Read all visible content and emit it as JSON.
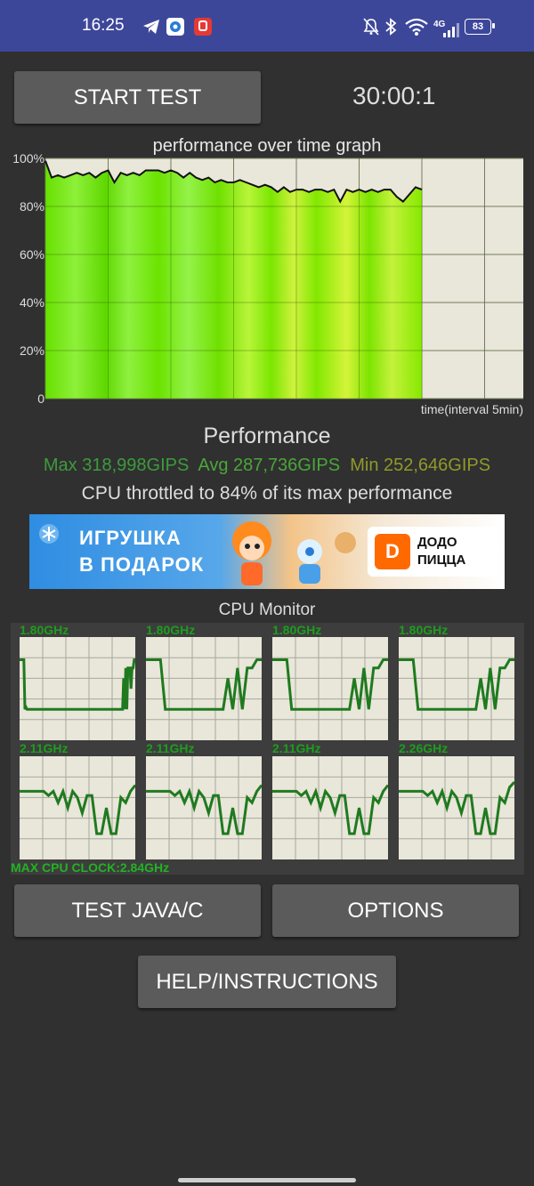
{
  "status_bar": {
    "time": "16:25",
    "network_label": "4G",
    "battery": "83",
    "icons": [
      "telegram-icon",
      "app-icon",
      "notification-app-icon",
      "bell-muted-icon",
      "bluetooth-icon",
      "wifi-icon",
      "signal-icon",
      "battery-icon"
    ]
  },
  "toolbar": {
    "start_label": "START TEST",
    "timer": "30:00:1"
  },
  "graph": {
    "title": "performance over time graph",
    "y_ticks": [
      "100%",
      "80%",
      "60%",
      "40%",
      "20%",
      "0"
    ],
    "x_label": "time(interval 5min)"
  },
  "chart_data": {
    "type": "area",
    "title": "performance over time graph",
    "xlabel": "time(interval 5min)",
    "ylabel": "",
    "ylim": [
      0,
      100
    ],
    "x_range_minutes": [
      0,
      30
    ],
    "grid": true,
    "series": [
      {
        "name": "",
        "x_minutes": [
          0,
          0.5,
          1,
          1.5,
          2,
          2.5,
          3,
          3.5,
          4,
          4.5,
          5,
          5.5,
          6,
          6.5,
          7,
          7.5,
          8,
          8.5,
          9,
          9.5,
          10,
          10.5,
          11,
          11.5,
          12,
          12.5,
          13,
          13.5,
          14,
          14.5,
          15,
          15.5,
          16,
          16.5,
          17,
          17.5,
          18,
          18.5,
          19,
          19.5,
          20,
          20.5,
          21,
          21.5,
          22,
          22.5,
          23,
          23.5,
          24,
          24.5,
          25,
          25.5,
          26,
          26.5,
          27,
          27.5,
          28,
          28.5,
          29,
          29.5,
          30
        ],
        "values": [
          99,
          92,
          93,
          92,
          93,
          94,
          93,
          94,
          92,
          94,
          95,
          90,
          94,
          93,
          94,
          93,
          95,
          95,
          95,
          94,
          95,
          94,
          92,
          94,
          92,
          91,
          92,
          90,
          91,
          90,
          90,
          91,
          90,
          89,
          88,
          89,
          88,
          86,
          88,
          86,
          87,
          87,
          86,
          87,
          87,
          86,
          87,
          82,
          87,
          86,
          87,
          86,
          87,
          86,
          87,
          87,
          84,
          82,
          85,
          88,
          87
        ]
      }
    ]
  },
  "performance": {
    "title": "Performance",
    "max": "Max 318,998GIPS",
    "avg": "Avg 287,736GIPS",
    "min": "Min 252,646GIPS",
    "max_color": "#3d9b3d",
    "avg_color": "#4aa63a",
    "min_color": "#8f9a2a",
    "throttle": "CPU throttled to 84% of its max performance"
  },
  "ad": {
    "line1": "ИГРУШКА",
    "line2": "В ПОДАРОК",
    "brand_line1": "ДОДО",
    "brand_line2": "ПИЦЦА",
    "brand_mark": "D"
  },
  "cpu_monitor": {
    "title": "CPU Monitor",
    "cores": [
      {
        "freq": "1.80GHz",
        "levels": [
          0.78,
          0.78,
          0.78,
          0.78,
          0.78,
          0.3,
          0.32,
          0.3,
          0.3,
          0.3,
          0.3,
          0.3,
          0.3,
          0.3,
          0.3,
          0.3,
          0.3,
          0.3,
          0.3,
          0.3,
          0.3,
          0.3,
          0.3,
          0.3,
          0.3,
          0.3,
          0.3,
          0.3,
          0.3,
          0.3,
          0.3,
          0.3,
          0.3,
          0.3,
          0.3,
          0.3,
          0.3,
          0.3,
          0.3,
          0.3,
          0.3,
          0.3,
          0.3,
          0.3,
          0.3,
          0.3,
          0.3,
          0.3,
          0.3,
          0.3,
          0.3,
          0.3,
          0.3,
          0.3,
          0.3,
          0.3,
          0.3,
          0.3,
          0.3,
          0.3,
          0.3,
          0.3,
          0.3,
          0.3,
          0.3,
          0.3,
          0.3,
          0.3,
          0.3,
          0.3,
          0.3,
          0.3,
          0.3,
          0.3,
          0.3,
          0.3,
          0.3,
          0.3,
          0.3,
          0.3,
          0.3,
          0.3,
          0.3,
          0.3,
          0.3,
          0.3,
          0.3,
          0.3,
          0.3,
          0.3,
          0.3,
          0.3,
          0.3,
          0.3,
          0.3,
          0.3,
          0.3,
          0.3,
          0.6,
          0.3,
          0.7,
          0.3,
          0.7,
          0.7,
          0.7,
          0.5,
          0.7,
          0.7,
          0.78,
          0.78
        ]
      },
      {
        "freq": "1.80GHz",
        "levels": [
          0.78,
          0.78,
          0.78,
          0.78,
          0.3,
          0.3,
          0.3,
          0.3,
          0.3,
          0.3,
          0.3,
          0.3,
          0.3,
          0.3,
          0.3,
          0.3,
          0.3,
          0.6,
          0.3,
          0.7,
          0.3,
          0.7,
          0.7,
          0.78,
          0.78
        ]
      },
      {
        "freq": "1.80GHz",
        "levels": [
          0.78,
          0.78,
          0.78,
          0.78,
          0.3,
          0.3,
          0.3,
          0.3,
          0.3,
          0.3,
          0.3,
          0.3,
          0.3,
          0.3,
          0.3,
          0.3,
          0.3,
          0.6,
          0.3,
          0.7,
          0.3,
          0.7,
          0.7,
          0.78,
          0.78
        ]
      },
      {
        "freq": "1.80GHz",
        "levels": [
          0.78,
          0.78,
          0.78,
          0.78,
          0.3,
          0.3,
          0.3,
          0.3,
          0.3,
          0.3,
          0.3,
          0.3,
          0.3,
          0.3,
          0.3,
          0.3,
          0.3,
          0.6,
          0.3,
          0.7,
          0.3,
          0.7,
          0.7,
          0.78,
          0.78
        ]
      },
      {
        "freq": "2.11GHz",
        "levels": [
          0.66,
          0.66,
          0.66,
          0.66,
          0.66,
          0.66,
          0.62,
          0.66,
          0.55,
          0.66,
          0.5,
          0.66,
          0.6,
          0.45,
          0.62,
          0.62,
          0.25,
          0.25,
          0.5,
          0.25,
          0.25,
          0.6,
          0.55,
          0.66,
          0.72
        ]
      },
      {
        "freq": "2.11GHz",
        "levels": [
          0.66,
          0.66,
          0.66,
          0.66,
          0.66,
          0.66,
          0.62,
          0.66,
          0.55,
          0.66,
          0.5,
          0.66,
          0.6,
          0.45,
          0.62,
          0.62,
          0.25,
          0.25,
          0.5,
          0.25,
          0.25,
          0.6,
          0.55,
          0.66,
          0.72
        ]
      },
      {
        "freq": "2.11GHz",
        "levels": [
          0.66,
          0.66,
          0.66,
          0.66,
          0.66,
          0.66,
          0.62,
          0.66,
          0.55,
          0.66,
          0.5,
          0.66,
          0.6,
          0.45,
          0.62,
          0.62,
          0.25,
          0.25,
          0.5,
          0.25,
          0.25,
          0.6,
          0.55,
          0.66,
          0.72
        ]
      },
      {
        "freq": "2.26GHz",
        "levels": [
          0.66,
          0.66,
          0.66,
          0.66,
          0.66,
          0.66,
          0.62,
          0.66,
          0.55,
          0.66,
          0.5,
          0.66,
          0.6,
          0.45,
          0.62,
          0.62,
          0.25,
          0.25,
          0.5,
          0.25,
          0.25,
          0.6,
          0.55,
          0.7,
          0.75
        ]
      }
    ],
    "max_clock": "MAX CPU CLOCK:2.84GHz"
  },
  "actions": {
    "test_label": "TEST JAVA/C",
    "options_label": "OPTIONS",
    "help_label": "HELP/INSTRUCTIONS"
  }
}
